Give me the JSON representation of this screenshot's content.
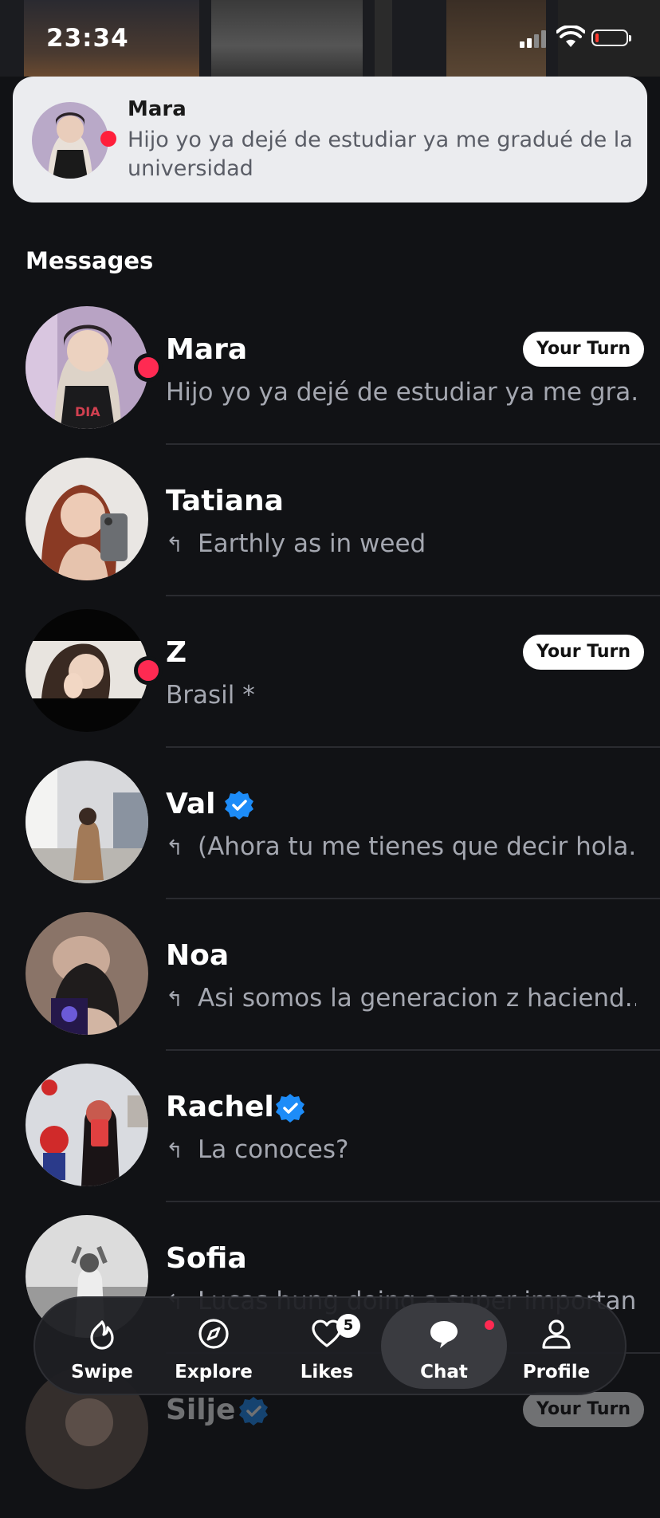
{
  "status_bar": {
    "time": "23:34"
  },
  "notification": {
    "sender": "Mara",
    "text": "Hijo yo ya dejé de estudiar ya me gradué de la universidad"
  },
  "section_title": "Messages",
  "conversations": [
    {
      "name": "Mara",
      "preview": "Hijo yo ya dejé de estudiar ya me gra...",
      "badge": "Your Turn"
    },
    {
      "name": "Tatiana",
      "preview": "Earthly as in weed"
    },
    {
      "name": "Z",
      "preview": "Brasil *",
      "badge": "Your Turn"
    },
    {
      "name": "Val",
      "preview": "(Ahora tu me tienes que decir hola..."
    },
    {
      "name": "Noa",
      "preview": "Asi somos la generacion z haciend..."
    },
    {
      "name": "Rachel",
      "preview": "La conoces?"
    },
    {
      "name": "Sofia",
      "preview": "Lucas hung doing a super important..."
    },
    {
      "name": "Silje",
      "badge": "Your Turn"
    }
  ],
  "nav": {
    "items": [
      {
        "label": "Swipe",
        "icon": "swipe-icon"
      },
      {
        "label": "Explore",
        "icon": "compass-icon"
      },
      {
        "label": "Likes",
        "icon": "heart-icon",
        "badge": "5"
      },
      {
        "label": "Chat",
        "icon": "chat-icon",
        "active": true
      },
      {
        "label": "Profile",
        "icon": "person-icon"
      }
    ]
  },
  "colors": {
    "background": "#111215",
    "unread": "#ff2a52",
    "verified": "#1d8cf8",
    "banner": "#ebecef"
  }
}
